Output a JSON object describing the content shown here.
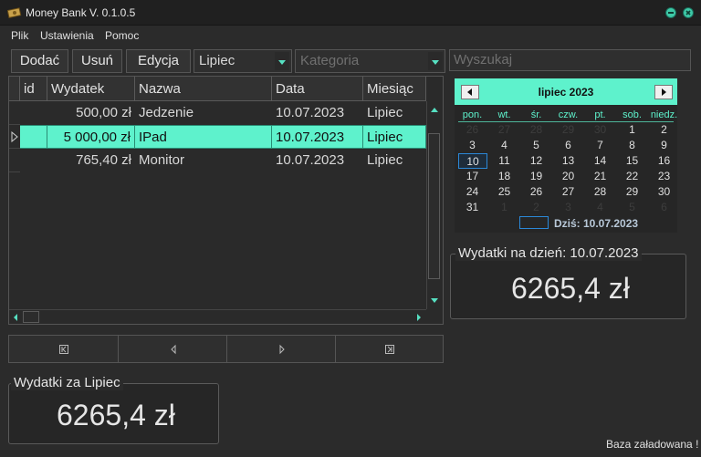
{
  "window": {
    "title": "Money Bank V. 0.1.0.5"
  },
  "menu": {
    "items": [
      "Plik",
      "Ustawienia",
      "Pomoc"
    ]
  },
  "toolbar": {
    "add_label": "Dodać",
    "delete_label": "Usuń",
    "edit_label": "Edycja",
    "month_value": "Lipiec",
    "category_placeholder": "Kategoria",
    "search_placeholder": "Wyszukaj"
  },
  "grid": {
    "columns": [
      "id",
      "Wydatek",
      "Nazwa",
      "Data",
      "Miesiąc"
    ],
    "rows": [
      {
        "id": "",
        "amount": "500,00 zł",
        "name": "Jedzenie",
        "date": "10.07.2023",
        "month": "Lipiec",
        "selected": false
      },
      {
        "id": "",
        "amount": "5 000,00 zł",
        "name": "IPad",
        "date": "10.07.2023",
        "month": "Lipiec",
        "selected": true
      },
      {
        "id": "",
        "amount": "765,40 zł",
        "name": "Monitor",
        "date": "10.07.2023",
        "month": "Lipiec",
        "selected": false
      }
    ]
  },
  "calendar": {
    "month_label": "lipiec 2023",
    "weekdays": [
      "pon.",
      "wt.",
      "śr.",
      "czw.",
      "pt.",
      "sob.",
      "niedz."
    ],
    "weeks": [
      [
        "26",
        "27",
        "28",
        "29",
        "30",
        "1",
        "2"
      ],
      [
        "3",
        "4",
        "5",
        "6",
        "7",
        "8",
        "9"
      ],
      [
        "10",
        "11",
        "12",
        "13",
        "14",
        "15",
        "16"
      ],
      [
        "17",
        "18",
        "19",
        "20",
        "21",
        "22",
        "23"
      ],
      [
        "24",
        "25",
        "26",
        "27",
        "28",
        "29",
        "30"
      ],
      [
        "31",
        "1",
        "2",
        "3",
        "4",
        "5",
        "6"
      ]
    ],
    "today_label": "Dziś: 10.07.2023"
  },
  "day_expenses": {
    "title": "Wydatki na dzień:  10.07.2023",
    "value": "6265,4 zł"
  },
  "month_expenses": {
    "title": "Wydatki za Lipiec",
    "value": "6265,4 zł"
  },
  "status": {
    "text": "Baza załadowana !"
  },
  "colors": {
    "accent": "#5ef2cc",
    "background": "#2b2b2b",
    "today_border": "#2b88d8"
  }
}
